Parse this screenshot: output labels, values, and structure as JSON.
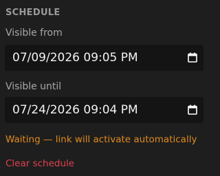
{
  "schedule": {
    "title": "SCHEDULE",
    "visible_from": {
      "label": "Visible from",
      "value": "07/09/2026 09:05 PM",
      "icon": "calendar-icon"
    },
    "visible_until": {
      "label": "Visible until",
      "value": "07/24/2026 09:04 PM",
      "icon": "calendar-icon"
    },
    "status": {
      "text": "Waiting — link will activate automatically",
      "color": "#e08a1e"
    },
    "clear": {
      "label": "Clear schedule",
      "color": "#e0414f"
    }
  },
  "colors": {
    "background": "#1e1e1e",
    "input_background": "#141414",
    "text_muted": "#a8a8a8",
    "input_text": "#f2f2f2"
  }
}
